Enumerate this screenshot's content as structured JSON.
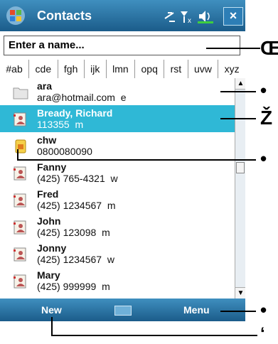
{
  "titlebar": {
    "title": "Contacts",
    "close": "×",
    "start_icon": "windows-flag-icon"
  },
  "search": {
    "value": "Enter a name..."
  },
  "tabs": [
    "#ab",
    "cde",
    "fgh",
    "ijk",
    "lmn",
    "opq",
    "rst",
    "uvw",
    "xyz"
  ],
  "contacts": [
    {
      "name": "ara",
      "detail": "ara@hotmail.com  e",
      "icon": "contact-card-blank-icon",
      "selected": false
    },
    {
      "name": "Bready, Richard",
      "detail": "113355  m",
      "icon": "contact-card-person-icon",
      "selected": true
    },
    {
      "name": "chw",
      "detail": "0800080090",
      "icon": "contact-card-sim-icon",
      "selected": false
    },
    {
      "name": "Fanny",
      "detail": "(425) 765-4321  w",
      "icon": "contact-card-person-icon",
      "selected": false
    },
    {
      "name": "Fred",
      "detail": "(425) 1234567  m",
      "icon": "contact-card-person-icon",
      "selected": false
    },
    {
      "name": "John",
      "detail": "(425) 123098  m",
      "icon": "contact-card-person-icon",
      "selected": false
    },
    {
      "name": "Jonny",
      "detail": "(425) 1234567  w",
      "icon": "contact-card-person-icon",
      "selected": false
    },
    {
      "name": "Mary",
      "detail": "(425) 999999  m",
      "icon": "contact-card-person-icon",
      "selected": false
    }
  ],
  "menubar": {
    "left": "New",
    "right": "Menu"
  },
  "callouts": [
    "Œ",
    "•",
    "Ž",
    "•",
    "•",
    "‘"
  ]
}
